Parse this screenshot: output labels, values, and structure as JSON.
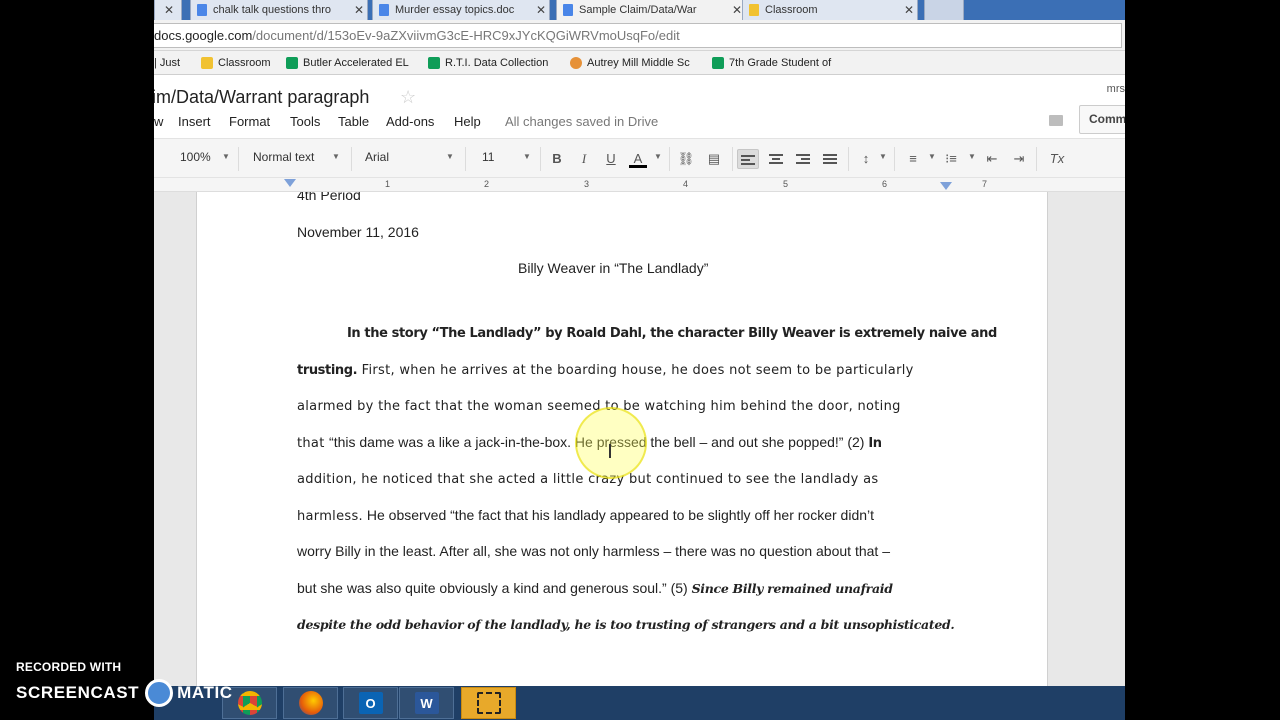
{
  "tabs": [
    {
      "label": "chalk talk questions thro",
      "active": false
    },
    {
      "label": "Murder essay topics.doc",
      "active": false
    },
    {
      "label": "Sample Claim/Data/War",
      "active": true
    },
    {
      "label": "Classroom",
      "active": false
    }
  ],
  "tab_close": "✕",
  "address": {
    "host": "docs.google.com",
    "path": "/document/d/153oEv-9aZXviivmG3cE-HRC9xJYcKQGiWRVmoUsqFo/edit"
  },
  "bookmarks": [
    {
      "label": "| Just",
      "icon": "none"
    },
    {
      "label": "Classroom",
      "icon": "classroom-icon"
    },
    {
      "label": "Butler Accelerated EL",
      "icon": "sheets-icon"
    },
    {
      "label": "R.T.I. Data Collection",
      "icon": "sheets-icon"
    },
    {
      "label": "Autrey Mill Middle Sc",
      "icon": "school-icon"
    },
    {
      "label": "7th Grade Student of",
      "icon": "sheets-icon"
    }
  ],
  "doc": {
    "title": "im/Data/Warrant paragraph",
    "user": "mrs",
    "save_status": "All changes saved in Drive",
    "comments_label": "Comm"
  },
  "menus": [
    "w",
    "Insert",
    "Format",
    "Tools",
    "Table",
    "Add-ons",
    "Help"
  ],
  "toolbar": {
    "zoom": "100%",
    "style": "Normal text",
    "font": "Arial",
    "size": "11",
    "bold": "B",
    "italic": "I",
    "underline": "U",
    "text_color": "A",
    "clear_format": "Tx"
  },
  "ruler_numbers": [
    "1",
    "2",
    "3",
    "4",
    "5",
    "6",
    "7"
  ],
  "document": {
    "period": "4th Period",
    "date": "November 11, 2016",
    "heading": "Billy Weaver in “The Landlady”",
    "lines": [
      [
        {
          "t": "In the story “The Landlady” by Roald Dahl, the character Billy Weaver is extremely naive and",
          "s": "handbold"
        }
      ],
      [
        {
          "t": "trusting.",
          "s": "handbold"
        },
        {
          "t": " First, when he arrives at the boarding house, he does not seem to be particularly",
          "s": "hand"
        }
      ],
      [
        {
          "t": "alarmed by the fact that the woman seemed to be watching him behind the door, noting",
          "s": "hand"
        }
      ],
      [
        {
          "t": "that ",
          "s": "hand"
        },
        {
          "t": "“this dame was a like a jack-in-the-box. He pressed the bell – and out she popped!” (2) ",
          "s": "arial"
        },
        {
          "t": "In",
          "s": "handbold"
        }
      ],
      [
        {
          "t": "addition, he noticed that she acted a little crazy but continued to see the landlady as",
          "s": "hand"
        }
      ],
      [
        {
          "t": "harmless.",
          "s": "hand"
        },
        {
          "t": " He observed “the fact that his landlady appeared to be slightly off her rocker didn’t",
          "s": "arial"
        }
      ],
      [
        {
          "t": "worry Billy in the least. After all, she was not only harmless – there was no question about that –",
          "s": "arial"
        }
      ],
      [
        {
          "t": "but she was also quite obviously a kind and generous soul.” (5) ",
          "s": "arial"
        },
        {
          "t": "Since Billy remained unafraid",
          "s": "handitalic"
        }
      ],
      [
        {
          "t": "despite the odd behavior of the landlady, he is too trusting of strangers and a bit unsophisticated.",
          "s": "handitalic"
        }
      ]
    ]
  },
  "watermark": {
    "line1": "RECORDED WITH",
    "line2a": "SCREENCAST",
    "line2b": "MATIC"
  },
  "taskbar_apps": [
    "chrome-icon",
    "firefox-icon",
    "outlook-icon",
    "word-icon",
    "snipping-icon"
  ],
  "colors": {
    "tabstrip": "#3b6fb5",
    "taskbar": "#1f3f66",
    "highlight": "#fff950"
  }
}
